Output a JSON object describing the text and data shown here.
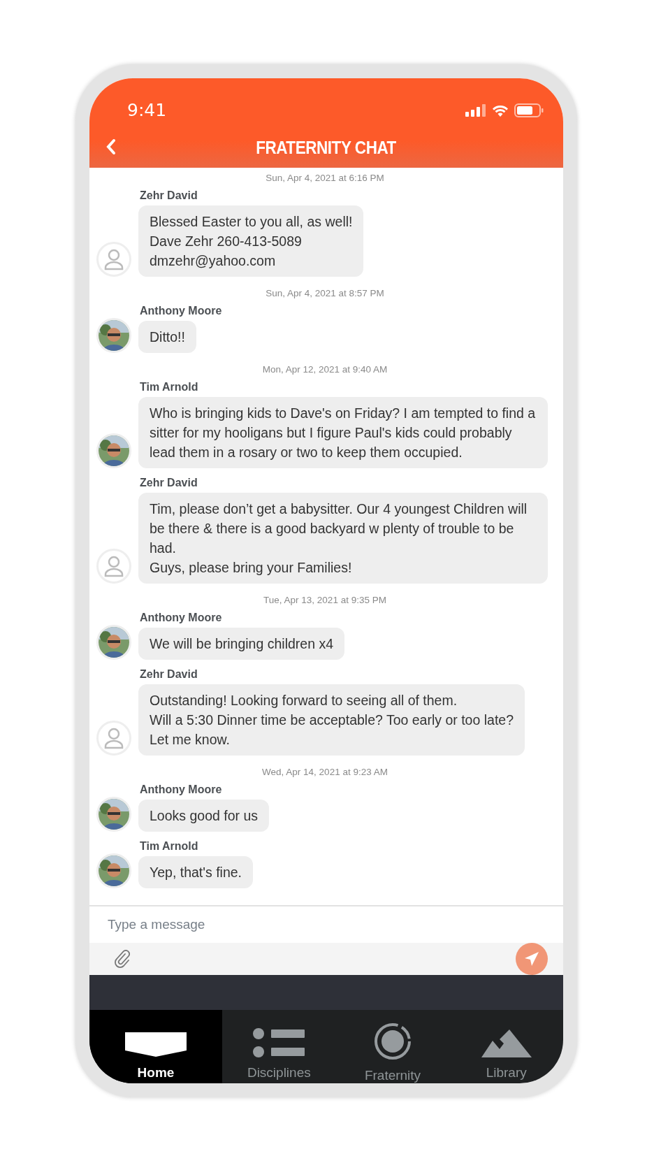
{
  "status_bar": {
    "time": "9:41"
  },
  "header": {
    "title": "FRATERNITY CHAT"
  },
  "messages": [
    {
      "kind": "date",
      "text": "Sun, Apr 4, 2021 at 6:16 PM"
    },
    {
      "kind": "message",
      "sender": "Zehr David",
      "avatar": {
        "kind": "default"
      },
      "text": "Blessed Easter to you all, as well!\nDave Zehr 260-413-5089\ndmzehr@yahoo.com"
    },
    {
      "kind": "date",
      "text": "Sun, Apr 4, 2021 at 8:57 PM"
    },
    {
      "kind": "message",
      "sender": "Anthony Moore",
      "text": "Ditto!!"
    },
    {
      "kind": "date",
      "text": "Mon, Apr 12, 2021 at 9:40 AM"
    },
    {
      "kind": "message",
      "sender": "Tim Arnold",
      "text": "Who is bringing kids to Dave's on Friday? I am tempted to find a sitter for my hooligans but I figure Paul's kids could probably lead them in a rosary or two to keep them occupied."
    },
    {
      "kind": "message",
      "sender": "Zehr David",
      "avatar": {
        "kind": "default"
      },
      "text": "Tim, please don’t get a babysitter. Our 4 youngest Children will be there & there is a good backyard w plenty of trouble to be had.\nGuys, please bring your Families!"
    },
    {
      "kind": "date",
      "text": "Tue, Apr 13, 2021 at 9:35 PM"
    },
    {
      "kind": "message",
      "sender": "Anthony Moore",
      "text": "We will be bringing children x4"
    },
    {
      "kind": "message",
      "sender": "Zehr David",
      "avatar": {
        "kind": "default"
      },
      "text": "Outstanding! Looking forward to seeing all of them.\nWill a 5:30 Dinner time be acceptable? Too early or too late?\nLet me know."
    },
    {
      "kind": "date",
      "text": "Wed, Apr 14, 2021 at 9:23 AM"
    },
    {
      "kind": "message",
      "sender": "Anthony Moore",
      "text": "Looks good for us"
    },
    {
      "kind": "message",
      "sender": "Tim Arnold",
      "text": "Yep, that's fine."
    }
  ],
  "composer": {
    "placeholder": "Type a message"
  },
  "tabs": [
    {
      "label": "Home",
      "selected": true
    },
    {
      "label": "Disciplines",
      "selected": false
    },
    {
      "label": "Fraternity",
      "selected": false
    },
    {
      "label": "Library",
      "selected": false
    }
  ]
}
